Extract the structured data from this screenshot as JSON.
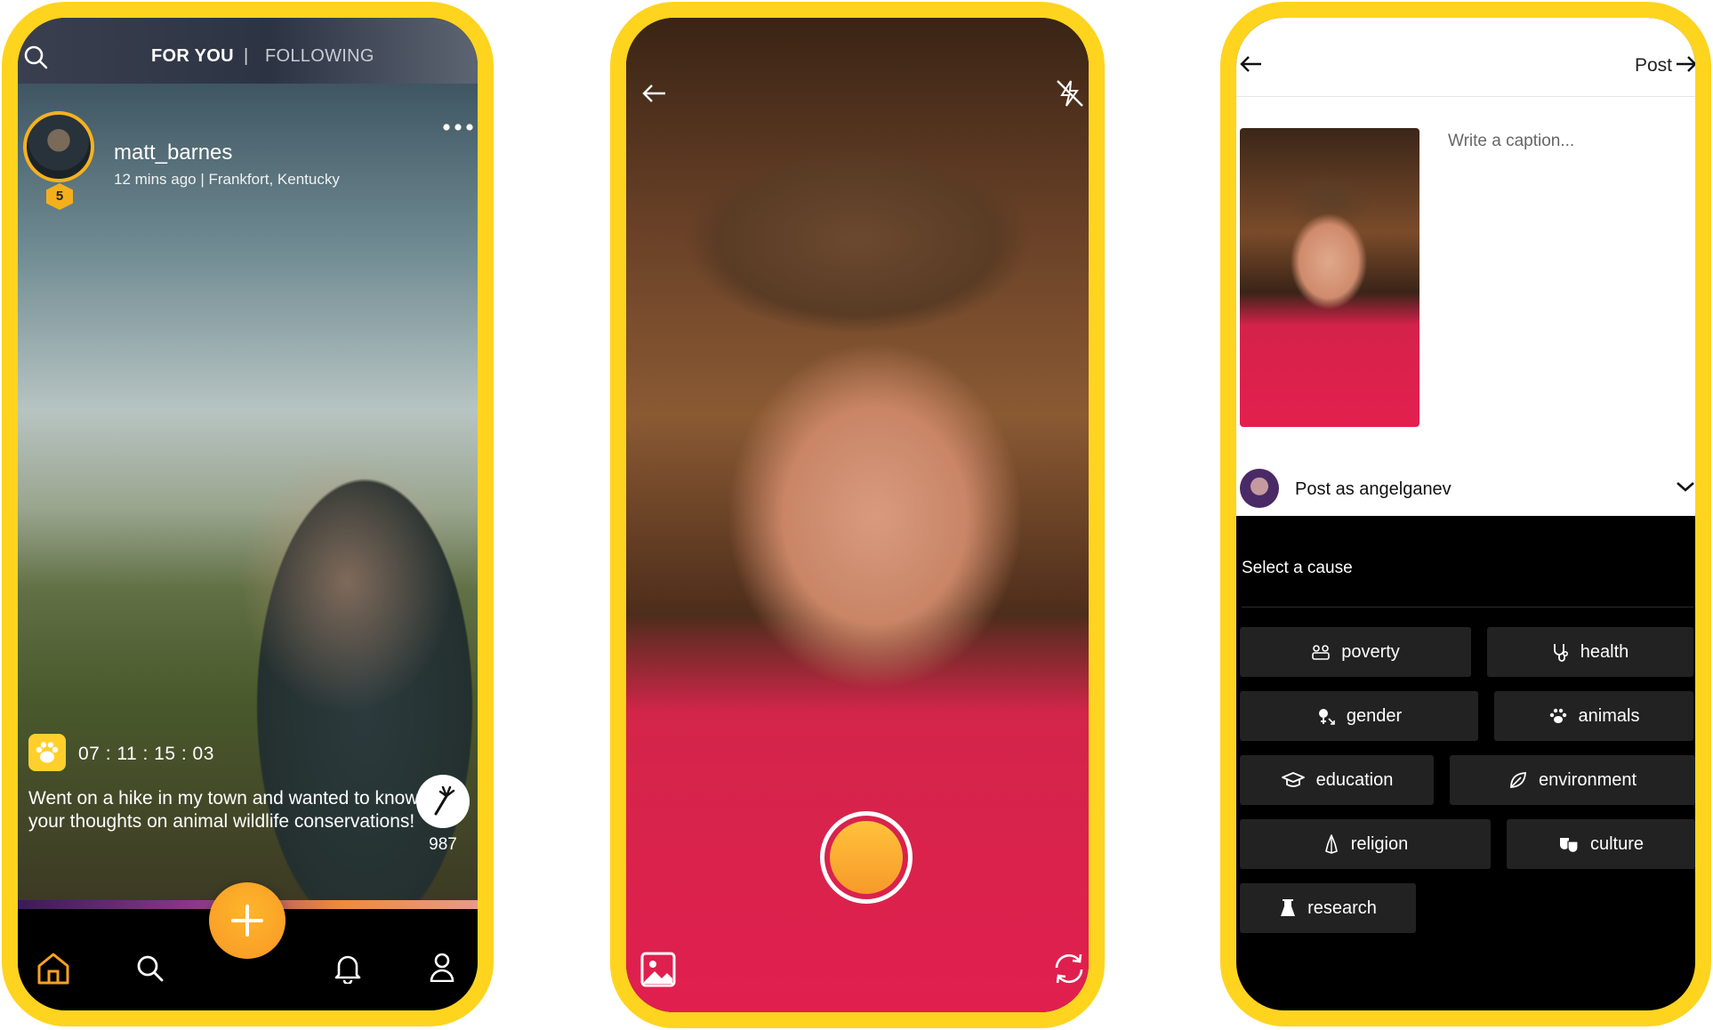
{
  "feed": {
    "tabs": {
      "for_you": "FOR YOU",
      "separator": "|",
      "following": "FOLLOWING"
    },
    "post": {
      "username": "matt_barnes",
      "meta": "12 mins ago | Frankfort, Kentucky",
      "level": "5",
      "timer": "07 : 11 : 15 : 03",
      "caption": "Went on a hike in my town and wanted to know your thoughts on animal wildlife conservations!",
      "likes": "987",
      "cause_icon": "paw-icon"
    },
    "nav": [
      "home-icon",
      "search-icon",
      "add-icon",
      "bell-icon",
      "profile-icon"
    ]
  },
  "camera": {
    "controls": [
      "back-arrow-icon",
      "flash-off-icon",
      "record-button",
      "gallery-icon",
      "switch-camera-icon"
    ]
  },
  "new_post": {
    "post_label": "Post",
    "caption_placeholder": "Write a caption...",
    "post_as": "Post as angelganev",
    "select_cause": "Select a cause",
    "causes": [
      "poverty",
      "health",
      "gender",
      "animals",
      "education",
      "environment",
      "religion",
      "culture",
      "research"
    ]
  },
  "colors": {
    "frame": "#FFD41F",
    "accent": "#F79726",
    "chip_bg": "#222222"
  }
}
